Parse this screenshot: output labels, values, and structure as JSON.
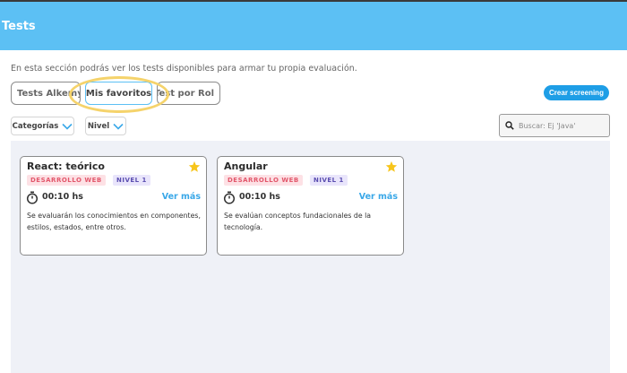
{
  "header": {
    "title": "Tests"
  },
  "intro": "En esta sección podrás ver los tests disponibles para armar tu propia evaluación.",
  "tabs": [
    {
      "label": "Tests Alkemy"
    },
    {
      "label": "Mis favoritos"
    },
    {
      "label": "Test por Rol"
    }
  ],
  "active_tab": "Mis favoritos",
  "create_button": "Crear screening",
  "filters": [
    {
      "label": "Categorías"
    },
    {
      "label": "Nivel"
    }
  ],
  "search": {
    "placeholder": "Buscar: Ej 'Java'"
  },
  "cards": [
    {
      "title": "React: teórico",
      "area": "DESARROLLO WEB",
      "level": "NIVEL 1",
      "time": "00:10 hs",
      "link": "Ver más",
      "description": "Se evaluarán los conocimientos en componentes, estilos, estados, entre otros.",
      "favorite": true
    },
    {
      "title": "Angular",
      "area": "DESARROLLO WEB",
      "level": "NIVEL 1",
      "time": "00:10 hs",
      "link": "Ver más",
      "description": "Se evalúan conceptos fundacionales de la tecnología.",
      "favorite": true
    }
  ],
  "colors": {
    "header": "#5cc0f4",
    "accent": "#1e9ee6",
    "link": "#3aa8e8",
    "star": "#f7c51b",
    "highlight": "#f5d36b",
    "area_badge_bg": "#fde1e5",
    "area_badge_fg": "#e2576b",
    "level_badge_bg": "#e9e5fb",
    "level_badge_fg": "#5a4db0",
    "content_bg": "#eff1f7"
  }
}
